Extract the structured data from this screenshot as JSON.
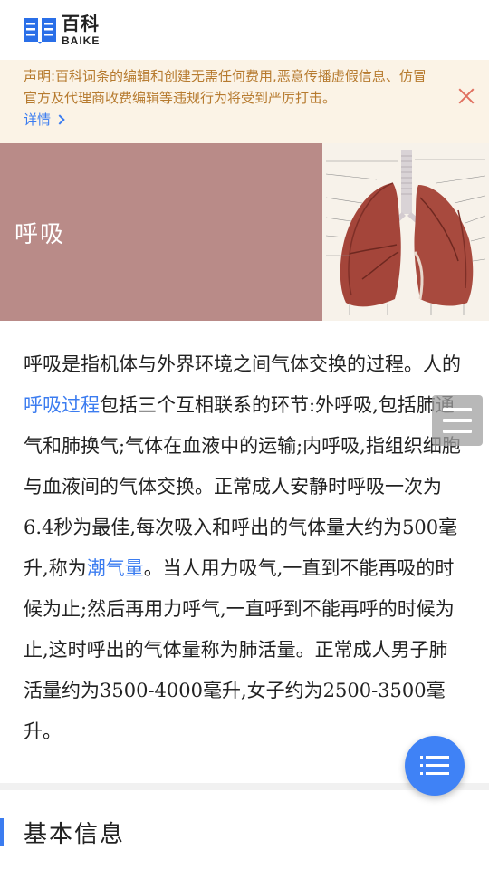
{
  "header": {
    "logo_cn": "百科",
    "logo_en": "BAIKE"
  },
  "notice": {
    "text": "声明:百科词条的编辑和创建无需任何费用,恶意传播虚假信息、仿冒官方及代理商收费编辑等违规行为将受到严厉打击。",
    "details_label": "详情"
  },
  "hero": {
    "title": "呼吸"
  },
  "article": {
    "p1_a": "呼吸是指机体与外界环境之间气体交换的过程。人的",
    "link1": "呼吸过程",
    "p1_b": "包括三个互相联系的环节:外呼吸,包括肺通气和肺换气;气体在血液中的运输;内呼吸,指组织细胞与血液间的气体交换。正常成人安静时呼吸一次为6.4秒为最佳,每次吸入和呼出的气体量大约为500毫升,称为",
    "link2": "潮气量",
    "p1_c": "。当人用力吸气,一直到不能再吸的时候为止;然后再用力呼气,一直呼到不能再呼的时候为止,这时呼出的气体量称为肺活量。正常成人男子肺活量约为3500-4000毫升,女子约为2500-3500毫升。"
  },
  "section": {
    "title": "基本信息"
  },
  "colors": {
    "accent": "#3b7cf0",
    "notice_bg": "#fbf3e6",
    "notice_text": "#b67a2e",
    "hero_bg": "#b98b88"
  },
  "icons": {
    "logo": "book-logo-icon",
    "close": "close-icon",
    "chevron": "chevron-right-icon",
    "side_menu": "menu-icon",
    "fab": "list-icon"
  }
}
